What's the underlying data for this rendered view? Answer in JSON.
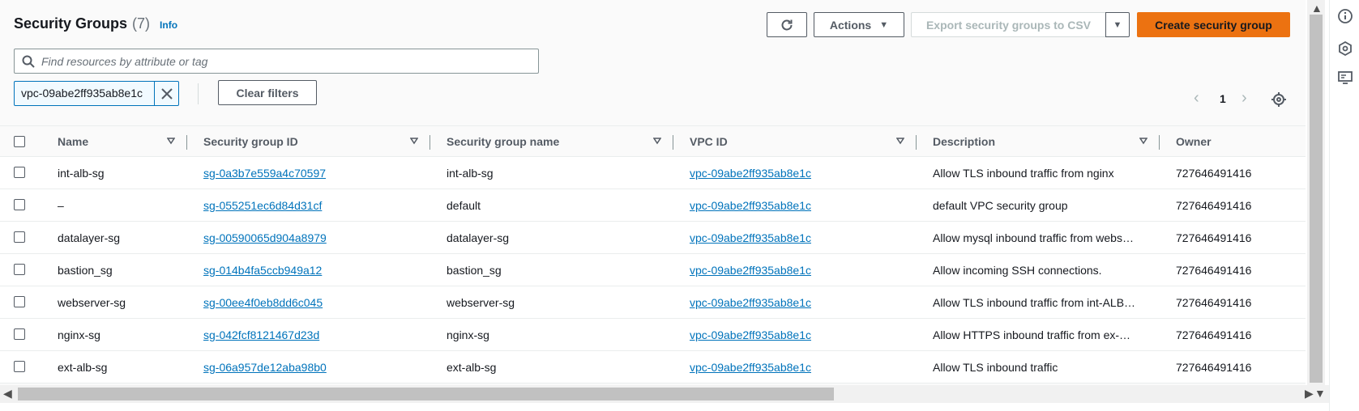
{
  "header": {
    "title": "Security Groups",
    "count": "(7)",
    "info": "Info"
  },
  "toolbar": {
    "actions_label": "Actions",
    "export_label": "Export security groups to CSV",
    "create_label": "Create security group"
  },
  "search": {
    "placeholder": "Find resources by attribute or tag"
  },
  "filter": {
    "token": "vpc-09abe2ff935ab8e1c",
    "clear_label": "Clear filters"
  },
  "pagination": {
    "current_page": "1"
  },
  "table": {
    "columns": [
      "Name",
      "Security group ID",
      "Security group name",
      "VPC ID",
      "Description",
      "Owner"
    ],
    "rows": [
      {
        "name": "int-alb-sg",
        "sg_id": "sg-0a3b7e559a4c70597",
        "sg_name": "int-alb-sg",
        "vpc_id": "vpc-09abe2ff935ab8e1c",
        "description": "Allow TLS inbound traffic from nginx",
        "owner": "727646491416"
      },
      {
        "name": "–",
        "sg_id": "sg-055251ec6d84d31cf",
        "sg_name": "default",
        "vpc_id": "vpc-09abe2ff935ab8e1c",
        "description": "default VPC security group",
        "owner": "727646491416"
      },
      {
        "name": "datalayer-sg",
        "sg_id": "sg-00590065d904a8979",
        "sg_name": "datalayer-sg",
        "vpc_id": "vpc-09abe2ff935ab8e1c",
        "description": "Allow mysql inbound traffic from webs…",
        "owner": "727646491416"
      },
      {
        "name": "bastion_sg",
        "sg_id": "sg-014b4fa5ccb949a12",
        "sg_name": "bastion_sg",
        "vpc_id": "vpc-09abe2ff935ab8e1c",
        "description": "Allow incoming SSH connections.",
        "owner": "727646491416"
      },
      {
        "name": "webserver-sg",
        "sg_id": "sg-00ee4f0eb8dd6c045",
        "sg_name": "webserver-sg",
        "vpc_id": "vpc-09abe2ff935ab8e1c",
        "description": "Allow TLS inbound traffic from int-ALB…",
        "owner": "727646491416"
      },
      {
        "name": "nginx-sg",
        "sg_id": "sg-042fcf8121467d23d",
        "sg_name": "nginx-sg",
        "vpc_id": "vpc-09abe2ff935ab8e1c",
        "description": "Allow HTTPS inbound traffic from ex-…",
        "owner": "727646491416"
      },
      {
        "name": "ext-alb-sg",
        "sg_id": "sg-06a957de12aba98b0",
        "sg_name": "ext-alb-sg",
        "vpc_id": "vpc-09abe2ff935ab8e1c",
        "description": "Allow TLS inbound traffic",
        "owner": "727646491416"
      }
    ]
  },
  "icons": {
    "refresh": "refresh-icon",
    "actions_caret": "caret-down-icon",
    "search": "search-icon",
    "token_close": "close-icon",
    "prev": "chevron-left-icon",
    "next": "chevron-right-icon",
    "settings": "gear-icon",
    "rail": [
      "info-icon",
      "hexagon-icon",
      "monitor-icon"
    ]
  },
  "colors": {
    "primary_button": "#ec7211",
    "link": "#0073bb",
    "text": "#16191f",
    "muted": "#545b64"
  }
}
